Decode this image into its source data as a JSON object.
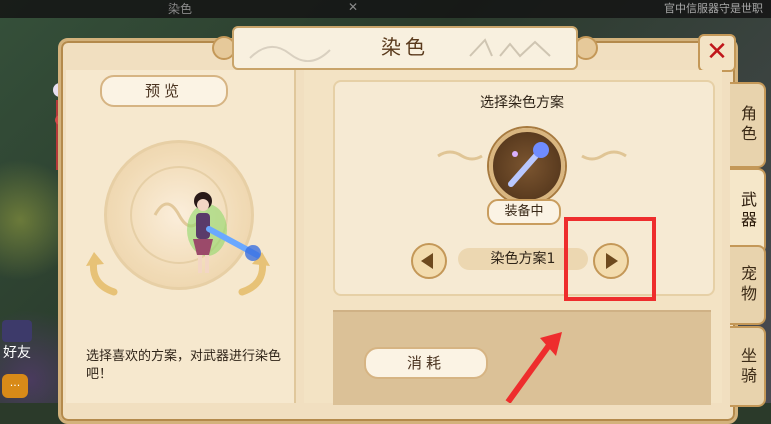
{
  "background": {
    "top_strip_title": "染色",
    "top_strip_close": "✕",
    "top_strip_right_text": "官中信服器守是世职",
    "left_badge_text": "好友",
    "left_chat_text": "···"
  },
  "dialog": {
    "title": "染色",
    "close_icon": "close-x-icon"
  },
  "preview": {
    "tag": "预览",
    "hint": "选择喜欢的方案，对武器进行染色吧！"
  },
  "scheme": {
    "title": "选择染色方案",
    "equip_badge": "装备中",
    "current_scheme": "染色方案1",
    "prev_icon": "triangle-left-icon",
    "next_icon": "triangle-right-icon"
  },
  "cost": {
    "tag": "消耗"
  },
  "side_tabs": [
    {
      "label": "角色",
      "active": false
    },
    {
      "label": "武器",
      "active": true
    },
    {
      "label": "宠物",
      "active": false
    },
    {
      "label": "坐骑",
      "active": false
    }
  ],
  "colors": {
    "highlight": "#ee2d2d",
    "close": "#c0161a",
    "panel": "#f1dfc0",
    "border": "#c49858"
  }
}
